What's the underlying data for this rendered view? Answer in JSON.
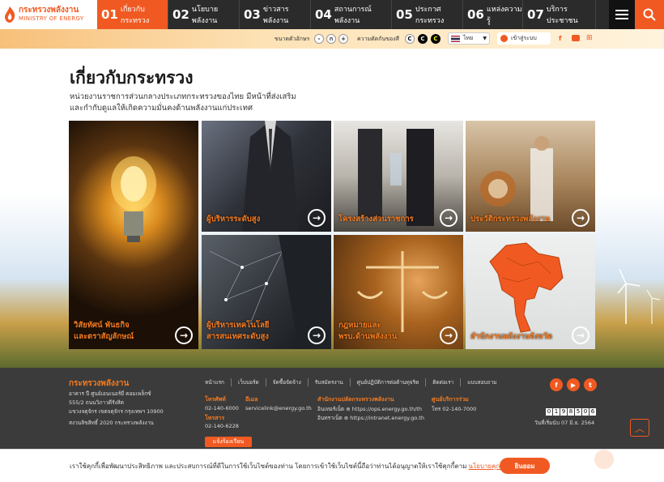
{
  "header": {
    "logo_th": "กระทรวงพลังงาน",
    "logo_en": "MINISTRY OF ENERGY",
    "nav": [
      {
        "num": "01",
        "label": "เกี่ยวกับกระทรวง"
      },
      {
        "num": "02",
        "label": "นโยบายพลังงาน"
      },
      {
        "num": "03",
        "label": "ข่าวสารพลังงาน"
      },
      {
        "num": "04",
        "label": "สถานการณ์พลังงาน"
      },
      {
        "num": "05",
        "label": "ประกาศกระทรวง"
      },
      {
        "num": "06",
        "label": "แหล่งความรู้"
      },
      {
        "num": "07",
        "label": "บริการประชาชน"
      }
    ]
  },
  "toolbar": {
    "font_size_label": "ขนาดตัวอักษร",
    "font_minus": "-",
    "font_normal": "ก",
    "font_plus": "+",
    "contrast_label": "ความตัดกันของสี",
    "contrast_options": [
      "C",
      "C",
      "C"
    ],
    "language": "ไทย",
    "login": "เข้าสู่ระบบ"
  },
  "main": {
    "title": "เกี่ยวกับกระทรวง",
    "description": "หน่วยงานราชการส่วนกลางประเภทกระทรวงของไทย มีหน้าที่ส่งเสริมและกำกับดูแลให้เกิดความมั่นคงด้านพลังงานแก่ประเทศ",
    "tiles": [
      {
        "line1": "วิสัยทัศน์ พันธกิจ",
        "line2": "และตราสัญลักษณ์"
      },
      {
        "line1": "ผู้บริหารระดับสูง",
        "line2": ""
      },
      {
        "line1": "โครงสร้างส่วนราชการ",
        "line2": ""
      },
      {
        "line1": "ประวัติกระทรวงพลังงาน",
        "line2": ""
      },
      {
        "line1": "ผู้บริหารเทคโนโลยี",
        "line2": "สารสนเทศระดับสูง"
      },
      {
        "line1": "กฎหมายและ",
        "line2": "พรบ.ด้านพลังงาน"
      },
      {
        "line1": "สำนักงานพลังงานจังหวัด",
        "line2": ""
      }
    ]
  },
  "footer": {
    "org_name": "กระทรวงพลังงาน",
    "address": [
      "อาคาร ปี ศูนย์เอนเนอร์ยี่ คอมเพล็กซ์",
      "555/2 ถนนวิภาวดีรังสิต",
      "แขวงจตุจักร เขตจตุจักร กรุงเทพฯ 10900"
    ],
    "copyright": "สงวนลิขสิทธิ์ 2020 กระทรวงพลังงาน",
    "links": [
      "หน้าแรก",
      "เว็บบอร์ด",
      "จัดซื้อจัดจ้าง",
      "รับสมัครงาน",
      "ศูนย์ปฏิบัติการต่อต้านทุจริต",
      "ติดต่อเรา",
      "แบบสอบถาม"
    ],
    "phone_label": "โทรศัพท์",
    "phone": "02-140-6000",
    "fax_label": "โทรสาร",
    "fax": "02-140-6228",
    "email_label": "อีเมล",
    "email": "servicelink@energy.go.th",
    "ops_label": "สำนักงานปลัดกระทรวงพลังงาน",
    "ops_internet_label": "อินเทอร์เน็ต",
    "ops_internet": "https://ops.energy.go.th/th",
    "ops_intranet_label": "อินทราเน็ต",
    "ops_intranet": "https://intranet.energy.go.th",
    "service_label": "ศูนย์บริการร่วม",
    "service_phone": "โทร 02-140-7000",
    "counter": [
      "0",
      "1",
      "9",
      "8",
      "5",
      "0",
      "6"
    ],
    "start_date": "วันที่เริ่มนับ 07 มิ.ย. 2564",
    "report_button": "แจ้งร้องเรียน",
    "social": [
      "f",
      "▶",
      "t"
    ]
  },
  "cookie": {
    "text": "เราใช้คุกกี้เพื่อพัฒนาประสิทธิภาพ และประสบการณ์ที่ดีในการใช้เว็บไซต์ของท่าน โดยการเข้าใช้เว็บไซต์นี้ถือว่าท่านได้อนุญาตให้เราใช้คุกกี้ตาม",
    "policy_link": "นโยบายคุกกี้",
    "accept_button": "ยินยอม"
  },
  "colors": {
    "accent": "#f05a22",
    "nav_bg": "#2b2b2b",
    "footer_bg": "#3b3b3b",
    "caption": "#f47b20"
  }
}
